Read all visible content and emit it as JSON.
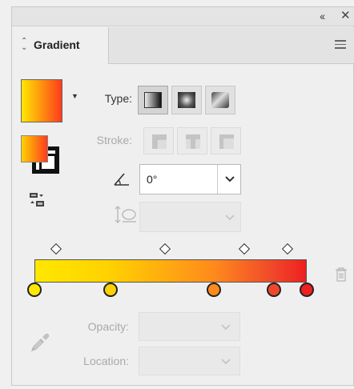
{
  "window": {
    "collapse_label": "‹‹",
    "close_label": "✕"
  },
  "tab": {
    "label": "Gradient"
  },
  "type": {
    "label": "Type:",
    "options": [
      "linear",
      "radial",
      "freeform"
    ],
    "selected": "linear"
  },
  "stroke": {
    "label": "Stroke:"
  },
  "angle": {
    "value": "0°"
  },
  "aspect": {
    "value": ""
  },
  "gradient": {
    "stops": [
      {
        "position": 0,
        "color": "#ffe800"
      },
      {
        "position": 28,
        "color": "#ffd000"
      },
      {
        "position": 66,
        "color": "#ff8a1c"
      },
      {
        "position": 88,
        "color": "#f0472a"
      },
      {
        "position": 100,
        "color": "#ee2020"
      }
    ],
    "midpoints": [
      8,
      48,
      77,
      93
    ]
  },
  "opacity": {
    "label": "Opacity:",
    "value": ""
  },
  "location": {
    "label": "Location:",
    "value": ""
  },
  "colors": {
    "accent_start": "#ffe800",
    "accent_end": "#ee2020"
  }
}
